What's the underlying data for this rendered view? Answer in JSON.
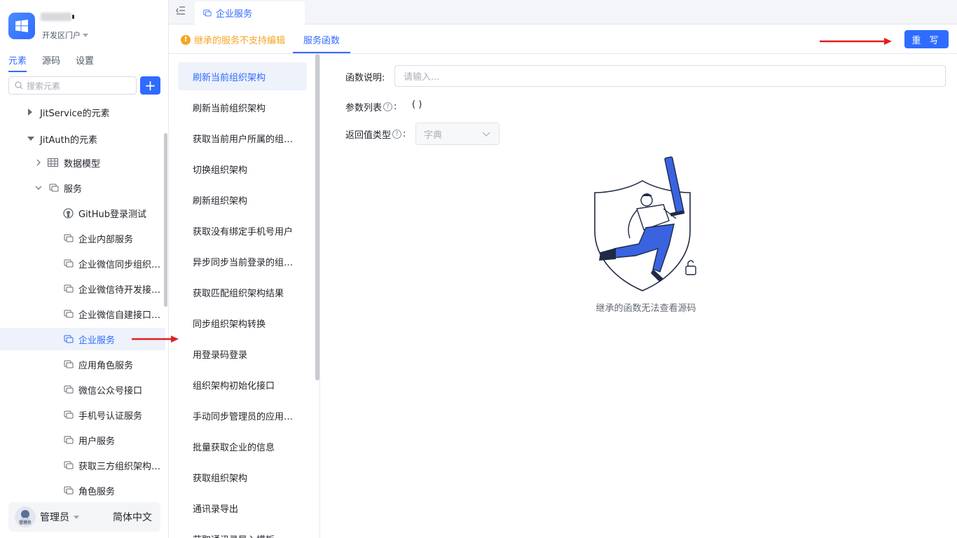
{
  "app": {
    "portal": "开发区门户"
  },
  "sidebar": {
    "tabs": [
      "元素",
      "源码",
      "设置"
    ],
    "active_tab": 0,
    "search_placeholder": "搜索元素",
    "add_label": "+",
    "tree": [
      {
        "label": "JitService的元素",
        "level": 0,
        "state": "collapsed"
      },
      {
        "label": "JitAuth的元素",
        "level": 0,
        "state": "expanded"
      },
      {
        "label": "数据模型",
        "level": 1,
        "state": "collapsed",
        "icon": "table-icon"
      },
      {
        "label": "服务",
        "level": 1,
        "state": "expanded",
        "icon": "service-icon"
      },
      {
        "label": "GitHub登录测试",
        "level": 2,
        "icon": "github-icon"
      },
      {
        "label": "企业内部服务",
        "level": 2,
        "icon": "service-icon"
      },
      {
        "label": "企业微信同步组织…",
        "level": 2,
        "icon": "service-icon"
      },
      {
        "label": "企业微信待开发接…",
        "level": 2,
        "icon": "service-icon"
      },
      {
        "label": "企业微信自建接口…",
        "level": 2,
        "icon": "service-icon"
      },
      {
        "label": "企业服务",
        "level": 2,
        "icon": "service-icon",
        "selected": true
      },
      {
        "label": "应用角色服务",
        "level": 2,
        "icon": "service-icon"
      },
      {
        "label": "微信公众号接口",
        "level": 2,
        "icon": "service-icon"
      },
      {
        "label": "手机号认证服务",
        "level": 2,
        "icon": "service-icon"
      },
      {
        "label": "用户服务",
        "level": 2,
        "icon": "service-icon"
      },
      {
        "label": "获取三方组织架构…",
        "level": 2,
        "icon": "service-icon"
      },
      {
        "label": "角色服务",
        "level": 2,
        "icon": "service-icon"
      }
    ],
    "user": {
      "name": "管理员",
      "avatar_label": "管理员",
      "language": "简体中文"
    }
  },
  "topbar": {
    "tab_label": "企业服务"
  },
  "subtabs": {
    "warning": "继承的服务不支持编辑",
    "active": "服务函数",
    "rewrite_button": "重 写"
  },
  "functions": {
    "items": [
      "刷新当前组织架构",
      "刷新当前组织架构",
      "获取当前用户所属的组…",
      "切换组织架构",
      "刷新组织架构",
      "获取没有绑定手机号用户",
      "异步同步当前登录的组…",
      "获取匹配组织架构结果",
      "同步组织架构转换",
      "用登录码登录",
      "组织架构初始化接口",
      "手动同步管理员的应用…",
      "批量获取企业的信息",
      "获取组织架构",
      "通讯录导出",
      "获取通讯录导入模板"
    ],
    "active_index": 0
  },
  "detail": {
    "desc_label": "函数说明:",
    "desc_placeholder": "请输入...",
    "params_label": "参数列表",
    "params_value": "(    )",
    "return_label": "返回值类型",
    "return_value": "字典",
    "empty_text": "继承的函数无法查看源码"
  },
  "colors": {
    "primary": "#2f6bff",
    "warning": "#f5a623",
    "annotation_arrow": "#e02020"
  }
}
